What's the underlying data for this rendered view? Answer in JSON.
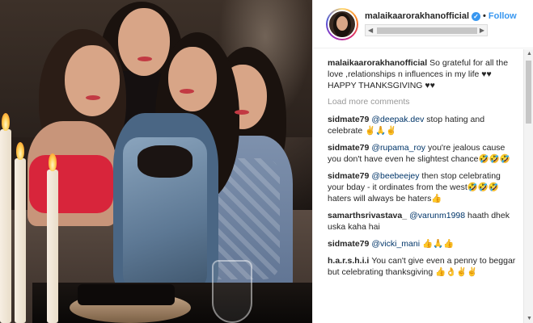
{
  "post": {
    "username": "malaikaarorakhanofficial",
    "verified_icon": "verified-badge-icon",
    "follow_label": "Follow",
    "separator": "•"
  },
  "comments": [
    {
      "user": "malaikaarorakhanofficial",
      "text": "So grateful for all the love ,relationships n influences in my life ♥♥ HAPPY THANKSGIVING ♥♥"
    }
  ],
  "load_more_label": "Load more comments",
  "thread": [
    {
      "user": "sidmate79",
      "mention": "@deepak.dev",
      "text": " stop hating and celebrate ✌🙏✌"
    },
    {
      "user": "sidmate79",
      "mention": "@rupama_roy",
      "text": " you're jealous cause you don't have even he slightest chance🤣🤣🤣"
    },
    {
      "user": "sidmate79",
      "mention": "@beebeejey",
      "text": " then stop celebrating your bday - it ordinates from the west🤣🤣🤣haters will always be haters👍"
    },
    {
      "user": "samarthsrivastava_",
      "mention": "@varunm1998",
      "text": " haath dhek uska kaha hai"
    },
    {
      "user": "sidmate79",
      "mention": "@vicki_mani",
      "text": " 👍🙏👍"
    },
    {
      "user": "h.a.r.s.h.i.i",
      "mention": "",
      "text": "You can't give even a penny to beggar but celebrating thanksgiving 👍👌✌✌"
    }
  ],
  "scrollbars": {
    "up_icon": "▲",
    "down_icon": "▼",
    "left_icon": "◀",
    "right_icon": "▶"
  },
  "colors": {
    "link": "#3897f0",
    "mention": "#003569",
    "muted": "#999999"
  }
}
